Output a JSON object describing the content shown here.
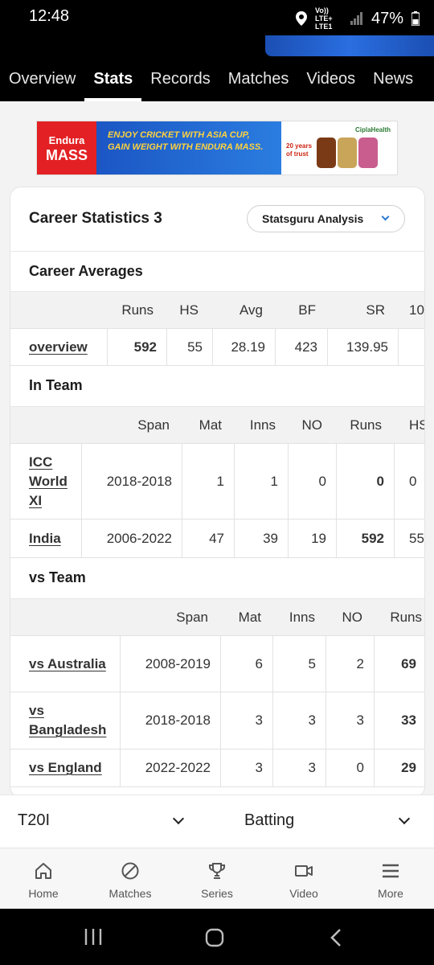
{
  "status": {
    "time": "12:48",
    "network": "Vo)) LTE+ LTE1",
    "battery": "47%"
  },
  "tabs": [
    "Overview",
    "Stats",
    "Records",
    "Matches",
    "Videos",
    "News"
  ],
  "active_tab": "Stats",
  "ad": {
    "brand_top": "Endura",
    "brand_bottom": "MASS",
    "message": "ENJOY CRICKET WITH ASIA CUP, GAIN WEIGHT WITH ENDURA MASS.",
    "years": "20 years of trust",
    "sponsor": "CiplaHealth"
  },
  "card": {
    "title": "Career Statistics 3",
    "statsguru_button": "Statsguru Analysis",
    "career_averages": {
      "heading": "Career Averages",
      "columns": [
        "Runs",
        "HS",
        "Avg",
        "BF",
        "SR",
        "10"
      ],
      "rows": [
        {
          "label": "overview",
          "cells": [
            "592",
            "55",
            "28.19",
            "423",
            "139.95",
            ""
          ]
        }
      ]
    },
    "in_team": {
      "heading": "In Team",
      "columns": [
        "Span",
        "Mat",
        "Inns",
        "NO",
        "Runs",
        "HS"
      ],
      "rows": [
        {
          "label": "ICC World XI",
          "cells": [
            "2018-2018",
            "1",
            "1",
            "0",
            "0",
            "0"
          ]
        },
        {
          "label": "India",
          "cells": [
            "2006-2022",
            "47",
            "39",
            "19",
            "592",
            "55"
          ]
        }
      ]
    },
    "vs_team": {
      "heading": "vs Team",
      "columns": [
        "Span",
        "Mat",
        "Inns",
        "NO",
        "Runs"
      ],
      "rows": [
        {
          "label": "vs Australia",
          "cells": [
            "2008-2019",
            "6",
            "5",
            "2",
            "69"
          ]
        },
        {
          "label": "vs Bangladesh",
          "cells": [
            "2018-2018",
            "3",
            "3",
            "3",
            "33"
          ]
        },
        {
          "label": "vs England",
          "cells": [
            "2022-2022",
            "3",
            "3",
            "0",
            "29"
          ]
        }
      ]
    }
  },
  "filters": {
    "format": "T20I",
    "discipline": "Batting"
  },
  "bottom_nav": [
    {
      "label": "Home",
      "icon": "home-icon"
    },
    {
      "label": "Matches",
      "icon": "ball-icon"
    },
    {
      "label": "Series",
      "icon": "trophy-icon"
    },
    {
      "label": "Video",
      "icon": "video-icon"
    },
    {
      "label": "More",
      "icon": "menu-icon"
    }
  ]
}
